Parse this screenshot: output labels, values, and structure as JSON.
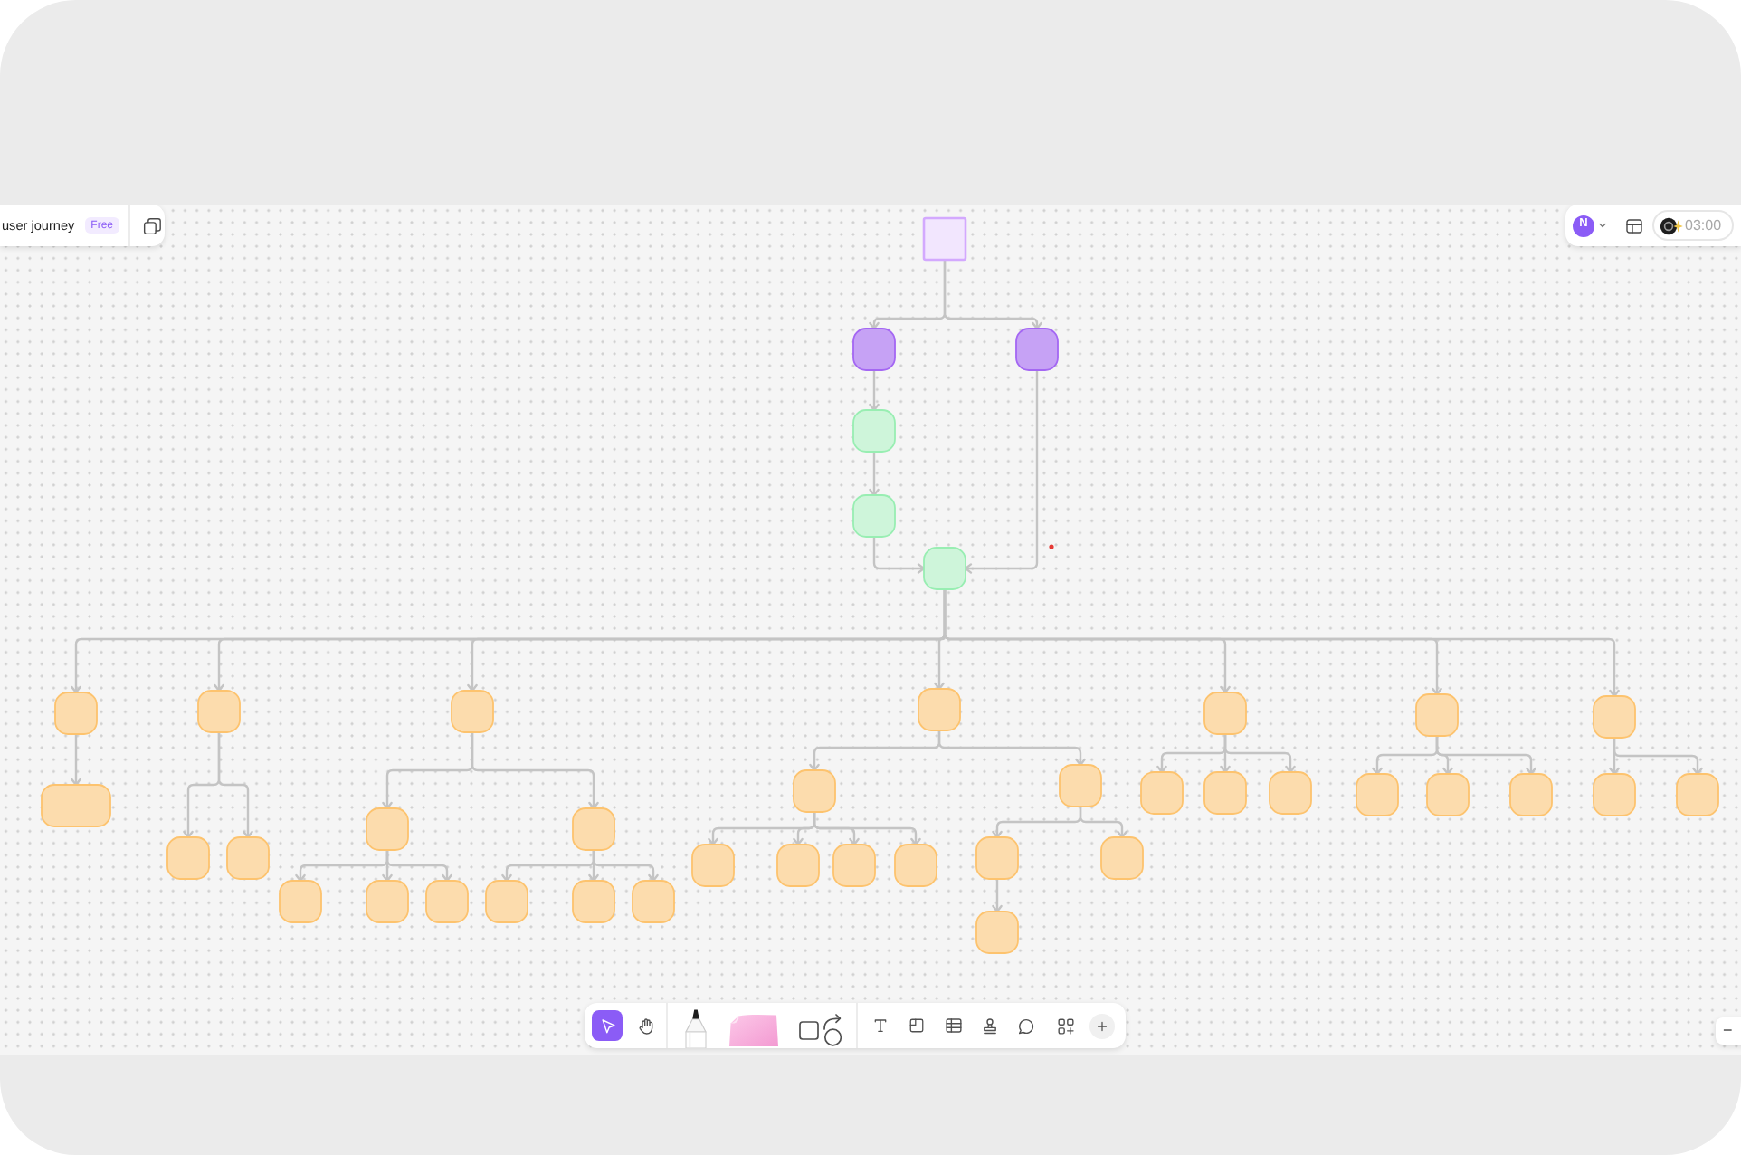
{
  "header": {
    "title": "user journey",
    "badge": "Free"
  },
  "collaboration": {
    "avatar_initial": "N",
    "timer": "03:00"
  },
  "diagram": {
    "root": {
      "kind": "square",
      "color": "#f2e6fe",
      "children": [
        {
          "kind": "rounded",
          "color": "#c6a2f5",
          "children": [
            {
              "kind": "rounded",
              "color": "#cef5da",
              "children": [
                {
                  "kind": "rounded",
                  "color": "#cef5da",
                  "children": [
                    {
                      "kind": "rounded",
                      "color": "#cef5da",
                      "children": [
                        {
                          "kind": "rounded",
                          "color": "#fcdcad",
                          "children": [
                            {
                              "kind": "rounded",
                              "color": "#fcdcad"
                            }
                          ]
                        },
                        {
                          "kind": "rounded",
                          "color": "#fcdcad",
                          "children": [
                            {
                              "kind": "rounded",
                              "color": "#fcdcad"
                            },
                            {
                              "kind": "rounded",
                              "color": "#fcdcad"
                            }
                          ]
                        },
                        {
                          "kind": "rounded",
                          "color": "#fcdcad",
                          "children": [
                            {
                              "kind": "rounded",
                              "color": "#fcdcad",
                              "children": [
                                {
                                  "kind": "rounded",
                                  "color": "#fcdcad"
                                },
                                {
                                  "kind": "rounded",
                                  "color": "#fcdcad"
                                },
                                {
                                  "kind": "rounded",
                                  "color": "#fcdcad"
                                }
                              ]
                            },
                            {
                              "kind": "rounded",
                              "color": "#fcdcad",
                              "children": [
                                {
                                  "kind": "rounded",
                                  "color": "#fcdcad"
                                },
                                {
                                  "kind": "rounded",
                                  "color": "#fcdcad"
                                },
                                {
                                  "kind": "rounded",
                                  "color": "#fcdcad"
                                }
                              ]
                            }
                          ]
                        },
                        {
                          "kind": "rounded",
                          "color": "#fcdcad",
                          "children": [
                            {
                              "kind": "rounded",
                              "color": "#fcdcad",
                              "children": [
                                {
                                  "kind": "rounded",
                                  "color": "#fcdcad"
                                },
                                {
                                  "kind": "rounded",
                                  "color": "#fcdcad"
                                },
                                {
                                  "kind": "rounded",
                                  "color": "#fcdcad"
                                },
                                {
                                  "kind": "rounded",
                                  "color": "#fcdcad"
                                }
                              ]
                            },
                            {
                              "kind": "rounded",
                              "color": "#fcdcad",
                              "children": [
                                {
                                  "kind": "rounded",
                                  "color": "#fcdcad",
                                  "children": [
                                    {
                                      "kind": "rounded",
                                      "color": "#fcdcad"
                                    }
                                  ]
                                },
                                {
                                  "kind": "rounded",
                                  "color": "#fcdcad"
                                }
                              ]
                            }
                          ]
                        },
                        {
                          "kind": "rounded",
                          "color": "#fcdcad",
                          "children": [
                            {
                              "kind": "rounded",
                              "color": "#fcdcad"
                            },
                            {
                              "kind": "rounded",
                              "color": "#fcdcad"
                            },
                            {
                              "kind": "rounded",
                              "color": "#fcdcad"
                            }
                          ]
                        },
                        {
                          "kind": "rounded",
                          "color": "#fcdcad",
                          "children": [
                            {
                              "kind": "rounded",
                              "color": "#fcdcad"
                            },
                            {
                              "kind": "rounded",
                              "color": "#fcdcad"
                            },
                            {
                              "kind": "rounded",
                              "color": "#fcdcad"
                            }
                          ]
                        },
                        {
                          "kind": "rounded",
                          "color": "#fcdcad",
                          "children": [
                            {
                              "kind": "rounded",
                              "color": "#fcdcad"
                            },
                            {
                              "kind": "rounded",
                              "color": "#fcdcad"
                            }
                          ]
                        }
                      ]
                    }
                  ]
                }
              ]
            }
          ]
        },
        {
          "kind": "rounded",
          "color": "#c6a2f5",
          "merges_into_previous": true
        }
      ]
    },
    "cursor_dot": {
      "color": "#e53935"
    }
  },
  "toolbar": {
    "tool_groups": [
      {
        "tools": [
          {
            "kind": "select",
            "selected": true
          },
          {
            "kind": "hand",
            "selected": false
          }
        ]
      },
      {
        "tools": [
          {
            "kind": "pen",
            "selected": false
          },
          {
            "kind": "sticky_note",
            "selected": false
          },
          {
            "kind": "shapes",
            "selected": false
          }
        ]
      },
      {
        "tools": [
          {
            "kind": "text",
            "selected": false
          },
          {
            "kind": "frame",
            "selected": false
          },
          {
            "kind": "table",
            "selected": false
          },
          {
            "kind": "stamp",
            "selected": false
          },
          {
            "kind": "comment",
            "selected": false
          },
          {
            "kind": "apps",
            "selected": false
          },
          {
            "kind": "add",
            "selected": false
          }
        ]
      }
    ]
  },
  "zoom_control": {
    "zoom_out": "−"
  }
}
